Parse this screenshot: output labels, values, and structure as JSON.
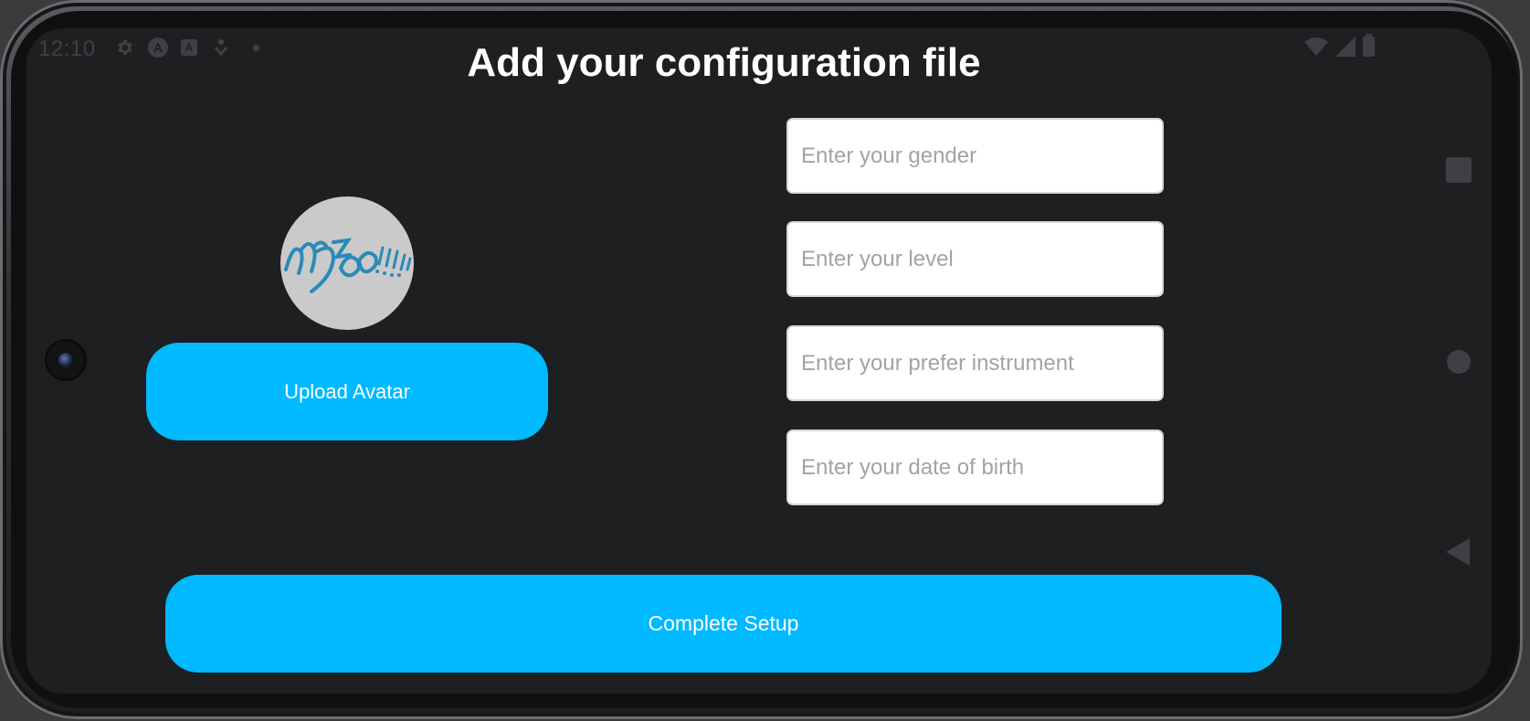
{
  "status_bar": {
    "time": "12:10",
    "left_icons": [
      "gear-icon",
      "app-a-icon",
      "font-a-icon",
      "download-icon",
      "dot-icon"
    ],
    "right_icons": [
      "wifi-icon",
      "signal-icon",
      "battery-icon"
    ],
    "app_a_letter": "A",
    "font_a_letter": "A"
  },
  "page": {
    "title": "Add your configuration file"
  },
  "avatar": {
    "caption": "Mzo!!!"
  },
  "upload_button": {
    "label": "Upload Avatar"
  },
  "form": {
    "gender_placeholder": "Enter your gender",
    "level_placeholder": "Enter your level",
    "instrument_placeholder": "Enter your prefer instrument",
    "dob_placeholder": "Enter your date of birth"
  },
  "complete_button": {
    "label": "Complete Setup"
  },
  "nav_bar": {
    "items": [
      "recents-square-icon",
      "home-circle-icon",
      "back-triangle-icon"
    ]
  },
  "colors": {
    "accent": "#00b9ff",
    "background": "#1e1f21",
    "title": "#ffffff",
    "avatar_bg": "#cacaca"
  }
}
